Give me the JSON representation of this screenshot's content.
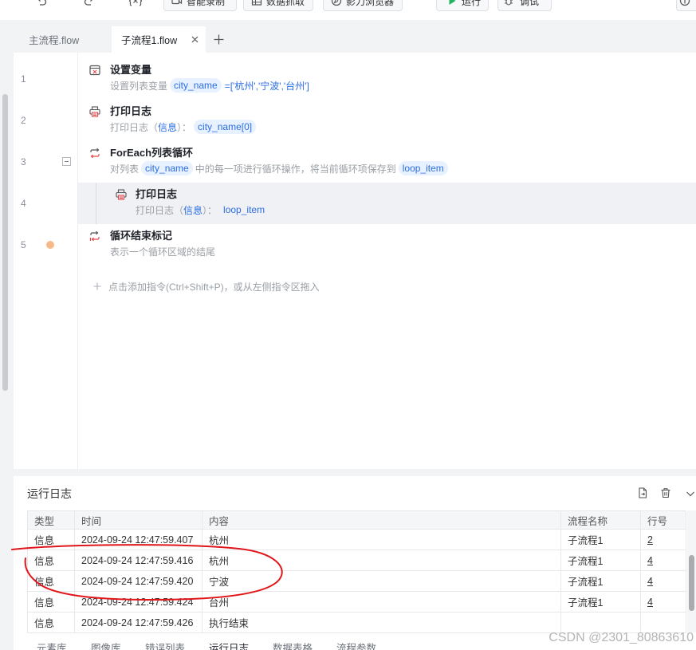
{
  "toolbar": {
    "smart_record": "智能录制",
    "data_scrape": "数据抓取",
    "browser": "影刀浏览器",
    "run": "运行",
    "debug": "调试"
  },
  "tabs": [
    {
      "label": "主流程.flow",
      "active": false
    },
    {
      "label": "子流程1.flow",
      "active": true
    }
  ],
  "editor": {
    "line_numbers": [
      "1",
      "2",
      "3",
      "4",
      "5"
    ],
    "steps": [
      {
        "icon": "set-variable-icon",
        "title": "设置变量",
        "desc": [
          "设置列表变量",
          "city_name",
          "=['杭州','宁波','台州']"
        ]
      },
      {
        "icon": "print-log-icon",
        "title": "打印日志",
        "desc": [
          "打印日志（",
          "信息",
          "）：",
          "city_name[0]"
        ]
      },
      {
        "icon": "foreach-loop-icon",
        "title": "ForEach列表循环",
        "desc": [
          "对列表",
          "city_name",
          "中的每一项进行循环操作，将当前循环项保存到",
          "loop_item"
        ]
      },
      {
        "icon": "print-log-icon",
        "title": "打印日志",
        "desc": [
          "打印日志（",
          "信息",
          "）：",
          "loop_item"
        ],
        "selected": true
      },
      {
        "icon": "loop-end-icon",
        "title": "循环结束标记",
        "desc": [
          "表示一个循环区域的结尾"
        ],
        "breakpoint": true
      }
    ],
    "add_hint": "点击添加指令(Ctrl+Shift+P)，或从左侧指令区拖入"
  },
  "run_log": {
    "title": "运行日志",
    "columns": [
      "类型",
      "时间",
      "内容",
      "流程名称",
      "行号"
    ],
    "rows": [
      [
        "信息",
        "2024-09-24 12:47:59.407",
        "杭州",
        "子流程1",
        "2"
      ],
      [
        "信息",
        "2024-09-24 12:47:59.416",
        "杭州",
        "子流程1",
        "4"
      ],
      [
        "信息",
        "2024-09-24 12:47:59.420",
        "宁波",
        "子流程1",
        "4"
      ],
      [
        "信息",
        "2024-09-24 12:47:59.424",
        "台州",
        "子流程1",
        "4"
      ],
      [
        "信息",
        "2024-09-24 12:47:59.426",
        "执行结束",
        "",
        ""
      ]
    ]
  },
  "bottom_tabs": [
    "元素库",
    "图像库",
    "错误列表",
    "运行日志",
    "数据表格",
    "流程参数"
  ],
  "watermark": "CSDN @2301_80863610",
  "colors": {
    "accent": "#2b6de5",
    "tag_bg": "#e8f1ff",
    "run_green": "#22b35e",
    "breakpoint": "#f6b98a",
    "selected_row": "#f0f1f4",
    "annotation_red": "#e0161b"
  }
}
